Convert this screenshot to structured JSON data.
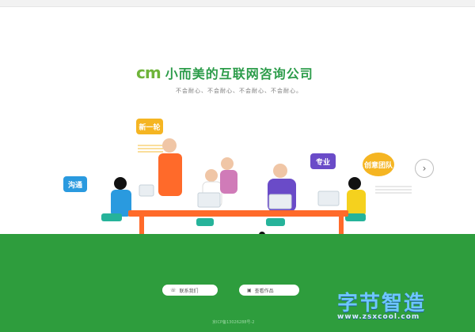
{
  "brand": {
    "logo_mark": "cm",
    "title": "小而美的互联网咨询公司",
    "tagline": "不会耐心、不会耐心、不会耐心、不会耐心。"
  },
  "bubbles": {
    "one": "新一轮",
    "two": "沟通",
    "three": "专业",
    "four": "创意团队"
  },
  "cta": {
    "left_label": "联系我们",
    "right_label": "查看作品"
  },
  "footer": {
    "icp": "京ICP备13026288号-2"
  },
  "watermark": {
    "title": "字节智造",
    "url": "www.zsxcool.com"
  },
  "colors": {
    "brand_green": "#2c9c4a",
    "accent_orange": "#ff6a2a",
    "accent_yellow": "#f5b522",
    "accent_blue": "#2a9adf",
    "accent_purple": "#6a4bc8",
    "ground_green": "#2e9d3d"
  }
}
